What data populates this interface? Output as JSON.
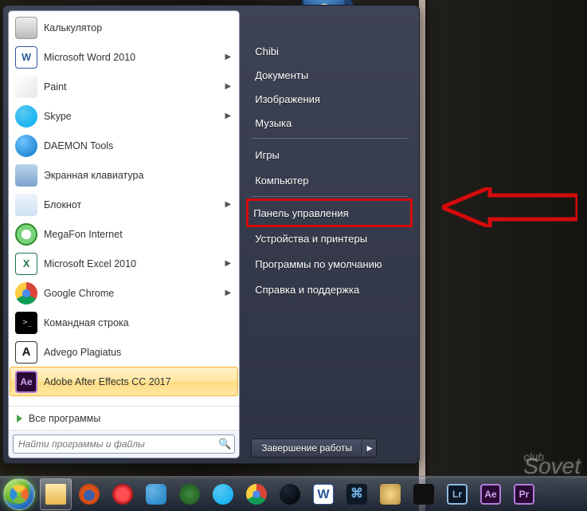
{
  "leftPane": {
    "programs": [
      {
        "label": "Калькулятор",
        "icon": "calc",
        "submenu": false
      },
      {
        "label": "Microsoft Word 2010",
        "icon": "word",
        "submenu": true,
        "letter": "W"
      },
      {
        "label": "Paint",
        "icon": "paint",
        "submenu": true
      },
      {
        "label": "Skype",
        "icon": "skype",
        "submenu": true
      },
      {
        "label": "DAEMON Tools",
        "icon": "daemon",
        "submenu": false
      },
      {
        "label": "Экранная клавиатура",
        "icon": "osk",
        "submenu": false
      },
      {
        "label": "Блокнот",
        "icon": "note",
        "submenu": true
      },
      {
        "label": "MegaFon Internet",
        "icon": "mega",
        "submenu": false
      },
      {
        "label": "Microsoft Excel 2010",
        "icon": "excel",
        "submenu": true,
        "letter": "X"
      },
      {
        "label": "Google Chrome",
        "icon": "chrome",
        "submenu": true
      },
      {
        "label": "Командная строка",
        "icon": "cmd",
        "submenu": false,
        "letter": ">_"
      },
      {
        "label": "Advego Plagiatus",
        "icon": "adv",
        "submenu": false,
        "letter": "A"
      },
      {
        "label": "Adobe After Effects CC 2017",
        "icon": "ae",
        "submenu": false,
        "letter": "Ae",
        "selected": true
      }
    ],
    "allPrograms": "Все программы",
    "searchPlaceholder": "Найти программы и файлы"
  },
  "rightPane": {
    "userName": "Chibi",
    "group1": [
      "Документы",
      "Изображения",
      "Музыка"
    ],
    "group2": [
      "Игры",
      "Компьютер"
    ],
    "group3": [
      {
        "label": "Панель управления",
        "highlight": true
      },
      {
        "label": "Устройства и принтеры"
      },
      {
        "label": "Программы по умолчанию"
      },
      {
        "label": "Справка и поддержка"
      }
    ],
    "shutdown": "Завершение работы"
  },
  "helpSymbol": "?",
  "watermark": {
    "small": "club",
    "big": "Sovet"
  },
  "taskbar": [
    {
      "name": "explorer",
      "cls": "ico-folder",
      "active": true
    },
    {
      "name": "firefox",
      "cls": "ico-ff"
    },
    {
      "name": "opera",
      "cls": "ico-opera"
    },
    {
      "name": "qbittorrent",
      "cls": "ico-qb"
    },
    {
      "name": "utorrent",
      "cls": "ico-ut"
    },
    {
      "name": "skype",
      "cls": "ico-skype"
    },
    {
      "name": "chrome",
      "cls": "ico-chrome"
    },
    {
      "name": "steam",
      "cls": "ico-steam"
    },
    {
      "name": "word",
      "cls": "ico-word",
      "letter": "W"
    },
    {
      "name": "battle-net",
      "cls": "ico-bnet",
      "letter": "⌘"
    },
    {
      "name": "hearthstone",
      "cls": "ico-hex"
    },
    {
      "name": "overwatch",
      "cls": "ico-ow"
    },
    {
      "name": "lightroom",
      "cls": "ico-lr",
      "letter": "Lr"
    },
    {
      "name": "after-effects",
      "cls": "ico-ae",
      "letter": "Ae"
    },
    {
      "name": "premiere",
      "cls": "ico-pr",
      "letter": "Pr"
    }
  ]
}
